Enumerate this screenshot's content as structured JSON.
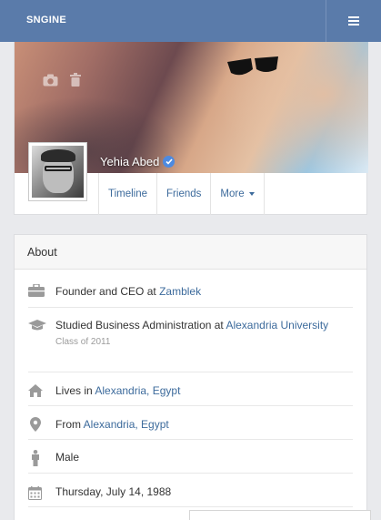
{
  "topbar": {
    "brand": "SNGINE",
    "menu_icon": "hamburger-icon",
    "color": "#5a7baa"
  },
  "profile": {
    "name": "Yehia Abed",
    "verified_icon": "verified-check-icon",
    "cover_actions": [
      "camera-icon",
      "trash-icon"
    ],
    "tabs": [
      {
        "label": "Timeline"
      },
      {
        "label": "Friends"
      },
      {
        "label": "More"
      }
    ]
  },
  "about": {
    "title": "About",
    "items": [
      {
        "icon": "briefcase-icon",
        "text": "Founder and CEO at ",
        "link": "Zamblek"
      },
      {
        "icon": "graduation-cap-icon",
        "text": "Studied Business Administration at ",
        "link": "Alexandria University",
        "sub": "Class of 2011"
      },
      {
        "icon": "home-icon",
        "text": "Lives in ",
        "link": "Alexandria, Egypt"
      },
      {
        "icon": "map-marker-icon",
        "text": "From ",
        "link": "Alexandria, Egypt"
      },
      {
        "icon": "male-icon",
        "text": "Male",
        "link": ""
      },
      {
        "icon": "calendar-icon",
        "text": "Thursday, July 14, 1988",
        "link": ""
      }
    ]
  },
  "colors": {
    "link": "#3d6b9c",
    "background": "#e9eaed"
  }
}
